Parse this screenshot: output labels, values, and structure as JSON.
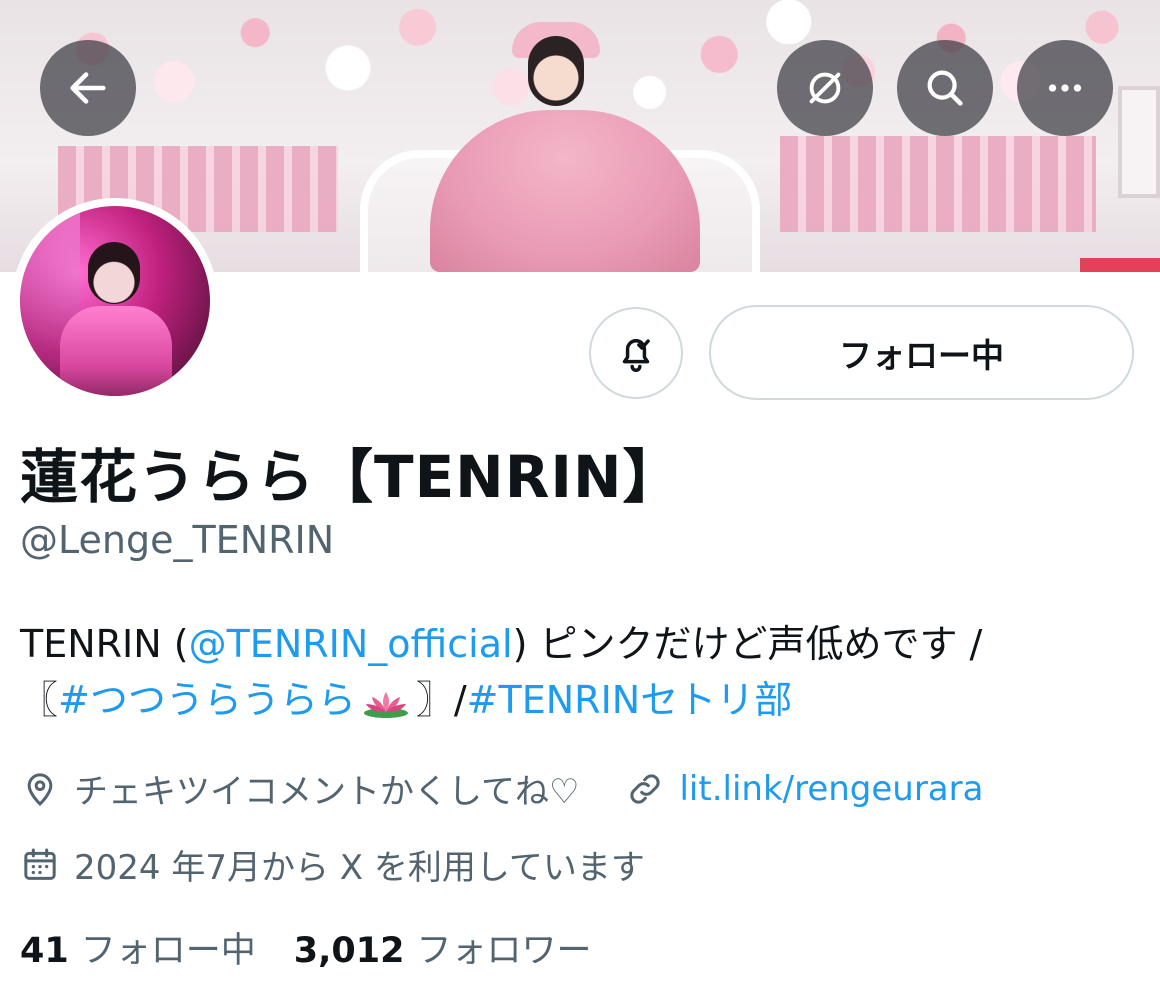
{
  "header": {
    "back_icon": "arrow-left-icon",
    "translate_off_icon": "globe-slash-icon",
    "search_icon": "search-icon",
    "more_icon": "more-horizontal-icon"
  },
  "actions": {
    "notification_icon": "bell-check-icon",
    "follow_button_label": "フォロー中"
  },
  "profile": {
    "display_name": "蓮花うらら【TENRIN】",
    "handle": "@Lenge_TENRIN",
    "bio": {
      "line1_prefix": "TENRIN (",
      "line1_mention": "@TENRIN_official",
      "line1_suffix": ") ピンクだけど声低めです /",
      "line2_open": "〖",
      "line2_hashtag1": "#つつうらうらら",
      "line2_close": "〗/",
      "line2_hashtag2": "#TENRINセトリ部"
    },
    "location": "チェキツイコメントかくしてね♡",
    "website": "lit.link/rengeurara",
    "joined": "2024 年7月から X を利用しています"
  },
  "stats": {
    "following_count": "41",
    "following_label": "フォロー中",
    "followers_count": "3,012",
    "followers_label": "フォロワー"
  },
  "colors": {
    "link": "#1d9bf0",
    "secondary_text": "#536471",
    "primary_text": "#0f1419",
    "border": "#cfd9de"
  }
}
